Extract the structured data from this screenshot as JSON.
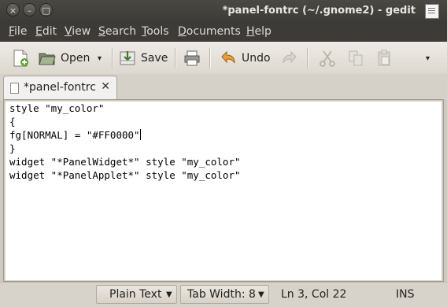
{
  "window": {
    "title": "*panel-fontrc (~/.gnome2) - gedit",
    "controls": [
      "×",
      "–",
      "□"
    ]
  },
  "menubar": [
    "File",
    "Edit",
    "View",
    "Search",
    "Tools",
    "Documents",
    "Help"
  ],
  "toolbar": {
    "open_label": "Open",
    "save_label": "Save",
    "undo_label": "Undo",
    "dropdown_arrow": "▾",
    "overflow_arrow": "▾"
  },
  "tab": {
    "label": "*panel-fontrc",
    "close": "✕"
  },
  "editor": {
    "lines": [
      "style \"my_color\"",
      "{",
      "fg[NORMAL] = \"#FF0000\"",
      "}",
      "widget \"*PanelWidget*\" style \"my_color\"",
      "widget \"*PanelApplet*\" style \"my_color\""
    ],
    "cursor_line": 3,
    "cursor_col": 22
  },
  "statusbar": {
    "language": "Plain Text",
    "tab_width": "Tab Width: 8",
    "position": "Ln 3, Col 22",
    "mode": "INS"
  }
}
